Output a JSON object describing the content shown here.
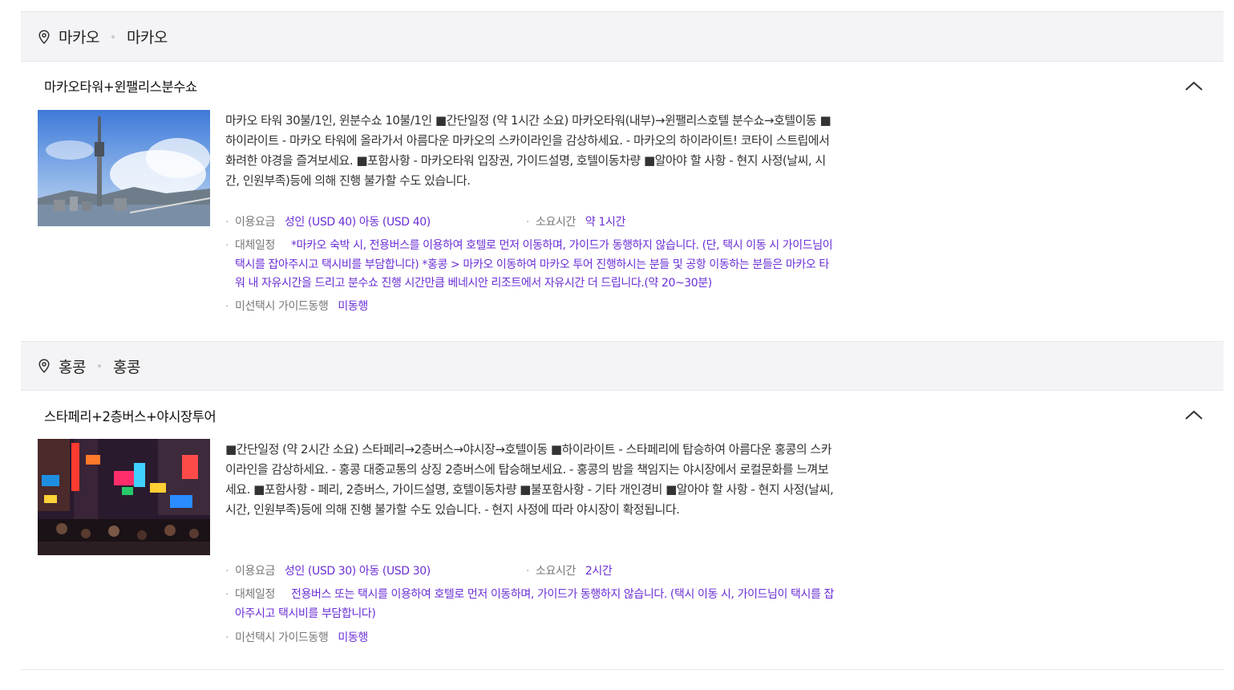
{
  "sections": [
    {
      "country": "마카오",
      "city": "마카오",
      "tour": {
        "title": "마카오타워+윈팰리스분수쇼",
        "description": "마카오 타워 30불/1인, 윈분수쇼 10불/1인 ■간단일정 (약 1시간 소요) 마카오타워(내부)→윈팰리스호텔 분수쇼→호텔이동 ■하이라이트 - 마카오 타워에 올라가서 아름다운 마카오의 스카이라인을 감상하세요. - 마카오의 하이라이트! 코타이 스트립에서 화려한 야경을 즐겨보세요. ■포함사항 - 마카오타워 입장권, 가이드설명, 호텔이동차량 ■알아야 할 사항 - 현지 사정(날씨, 시간, 인원부족)등에 의해 진행 불가할 수도 있습니다.",
        "price_label": "이용요금",
        "price_value": "성인 (USD 40) 아동 (USD 40)",
        "duration_label": "소요시간",
        "duration_value": "약 1시간",
        "alt_label": "대체일정",
        "alt_value": "*마카오 숙박 시, 전용버스를 이용하여 호텔로 먼저 이동하며, 가이드가 동행하지 않습니다. (단, 택시 이동 시 가이드님이 택시를 잡아주시고 택시비를 부담합니다) *홍콩 > 마카오 이동하여 마카오 투어 진행하시는 분들 및 공항 이동하는 분들은 마카오 타워 내 자유시간을 드리고 분수쇼 진행 시간만큼 베네시안 리조트에서 자유시간 더 드립니다.(약 20~30분)",
        "guide_label": "미선택시 가이드동행",
        "guide_value": "미동행"
      }
    },
    {
      "country": "홍콩",
      "city": "홍콩",
      "tour": {
        "title": "스타페리+2층버스+야시장투어",
        "description": "■간단일정 (약 2시간 소요) 스타페리→2층버스→야시장→호텔이동 ■하이라이트 - 스타페리에 탑승하여 아름다운 홍콩의 스카이라인을 감상하세요. - 홍콩 대중교통의 상징 2층버스에 탑승해보세요. - 홍콩의 밤을 책임지는 야시장에서 로컬문화를 느껴보세요. ■포함사항 - 페리, 2층버스, 가이드설명, 호텔이동차량 ■불포함사항 - 기타 개인경비 ■알아야 할 사항 - 현지 사정(날씨, 시간, 인원부족)등에 의해 진행 불가할 수도 있습니다. - 현지 사정에 따라 야시장이 확정됩니다.",
        "price_label": "이용요금",
        "price_value": "성인 (USD 30) 아동 (USD 30)",
        "duration_label": "소요시간",
        "duration_value": "2시간",
        "alt_label": "대체일정",
        "alt_value": "전용버스 또는 택시를 이용하여 호텔로 먼저 이동하며, 가이드가 동행하지 않습니다. (택시 이동 시, 가이드님이 택시를 잡아주시고 택시비를 부담합니다)",
        "guide_label": "미선택시 가이드동행",
        "guide_value": "미동행"
      }
    }
  ],
  "icons": {
    "location": "location-pin-icon",
    "collapse": "chevron-up-icon"
  },
  "colors": {
    "accent": "#6b2fd6",
    "header_bg": "#f4f4f6"
  }
}
